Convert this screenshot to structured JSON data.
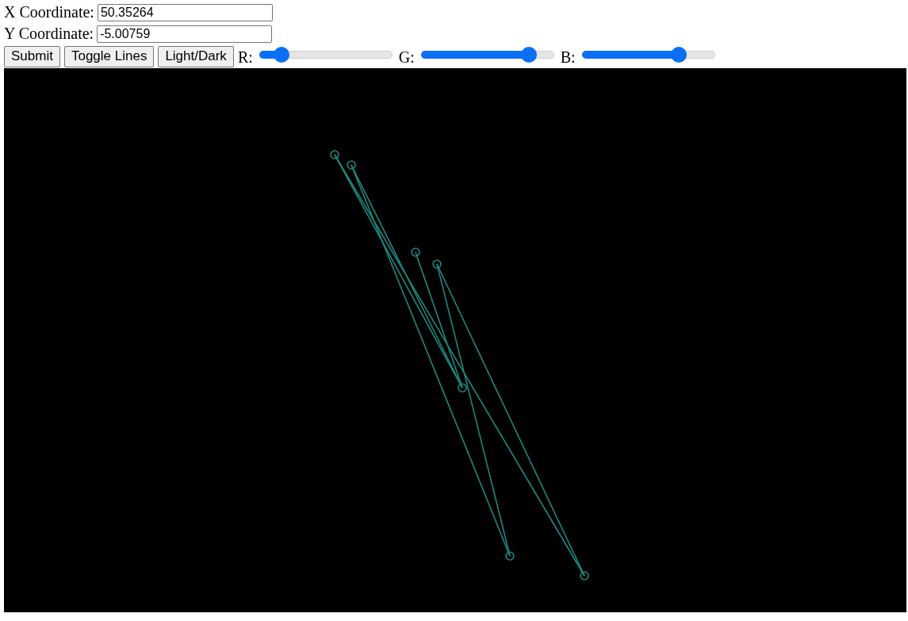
{
  "fields": [
    {
      "label": "X Coordinate:",
      "value": "50.35264"
    },
    {
      "label": "Y Coordinate:",
      "value": "-5.00759"
    }
  ],
  "buttons": [
    "Submit",
    "Toggle Lines",
    "Light/Dark"
  ],
  "sliders": [
    {
      "label": "R:",
      "level": 0.17
    },
    {
      "label": "G:",
      "level": 0.81
    },
    {
      "label": "B:",
      "level": 0.73
    }
  ]
}
